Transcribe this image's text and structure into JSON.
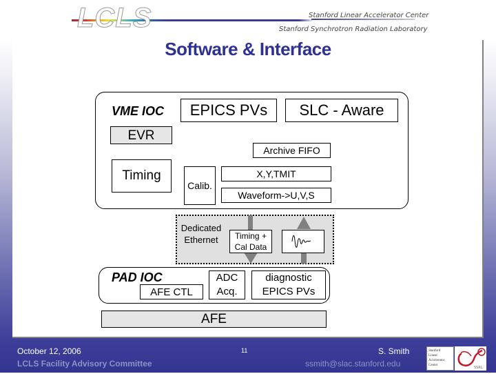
{
  "header": {
    "logo_text": "LCLS",
    "org_line_1": "Stanford Linear Accelerator Center",
    "org_line_2": "Stanford Synchrotron Radiation Laboratory"
  },
  "slide": {
    "title": "Software & Interface"
  },
  "diagram": {
    "vme_ioc": {
      "label": "VME IOC",
      "epics_pvs": "EPICS PVs",
      "slc_aware": "SLC - Aware",
      "evr": "EVR",
      "archive_fifo": "Archive FIFO",
      "timing": "Timing",
      "calib": "Calib.",
      "xy_tmit": "X,Y,TMIT",
      "waveform": "Waveform->U,V,S"
    },
    "ethernet": {
      "label_line1": "Dedicated",
      "label_line2": "Ethernet",
      "timing_cal_line1": "Timing +",
      "timing_cal_line2": "Cal Data",
      "waveform_icon": "waveform-icon"
    },
    "pad_ioc": {
      "label": "PAD IOC",
      "afe_ctl": "AFE CTL",
      "adc_line1": "ADC",
      "adc_line2": "Acq.",
      "diag_line1": "diagnostic",
      "diag_line2": "EPICS PVs"
    },
    "afe": "AFE",
    "colors": {
      "title": "#2e3192",
      "gray_fill": "#e6e6e6",
      "arrow": "#808080"
    }
  },
  "footer": {
    "date": "October 12, 2006",
    "committee": "LCLS Facility Advisory Committee",
    "page_number": "11",
    "author": "S. Smith",
    "email": "ssmith@slac.stanford.edu",
    "stanford_logo_lines": [
      "Stanford",
      "Linear",
      "Accelerator",
      "Center"
    ],
    "ssrl_logo": "SSRL"
  }
}
